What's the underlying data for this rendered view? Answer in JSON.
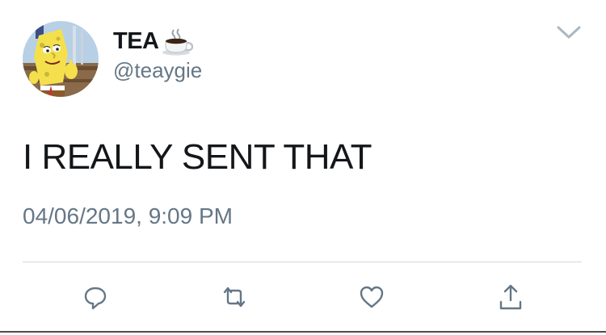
{
  "tweet": {
    "display_name": "TEA",
    "name_emoji": "coffee-cup-icon",
    "handle": "@teaygie",
    "text": "I REALLY SENT THAT",
    "timestamp": "04/06/2019, 9:09 PM",
    "avatar": "spongebob-avatar"
  },
  "actions": [
    "reply-icon",
    "retweet-icon",
    "like-icon",
    "share-icon"
  ],
  "colors": {
    "text_primary": "#14171a",
    "text_secondary": "#657786",
    "icon_gray": "#657786",
    "divider": "#d3d7db"
  }
}
